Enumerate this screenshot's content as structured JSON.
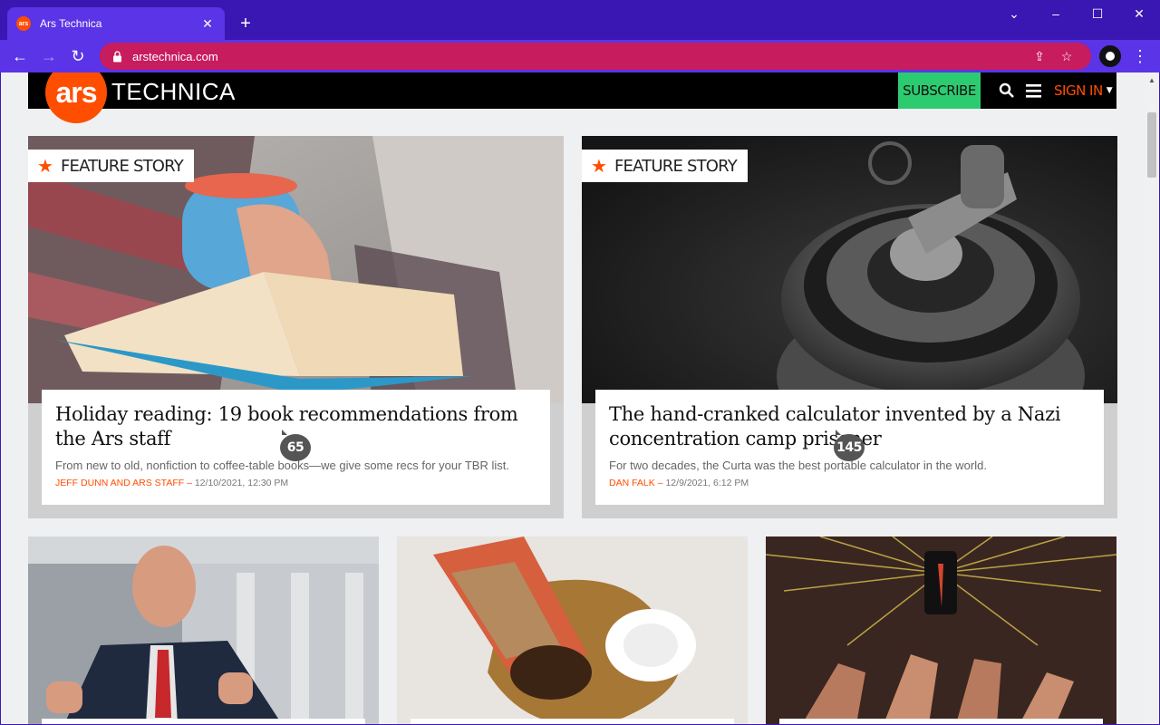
{
  "browser": {
    "tab_title": "Ars Technica",
    "favicon_text": "ars",
    "url": "arstechnica.com"
  },
  "site": {
    "logo_ars": "ars",
    "logo_technica": "TECHNICA",
    "subscribe_label": "SUBSCRIBE",
    "signin_label": "SIGN IN",
    "brand_color": "#ff4e00",
    "subscribe_color": "#2dcb70"
  },
  "features": [
    {
      "badge": "FEATURE STORY",
      "title": "Holiday reading: 19 book recommendations from the Ars staff",
      "excerpt": "From new to old, nonfiction to coffee-table books—we give some recs for your TBR list.",
      "author": "JEFF DUNN AND ARS STAFF",
      "date": "12/10/2021, 12:30 PM",
      "comments": "65"
    },
    {
      "badge": "FEATURE STORY",
      "title": "The hand-cranked calculator invented by a Nazi concentration camp prisoner",
      "excerpt": "For two decades, the Curta was the best portable calculator in the world.",
      "author": "DAN FALK",
      "date": "12/9/2021, 6:12 PM",
      "comments": "145"
    }
  ]
}
